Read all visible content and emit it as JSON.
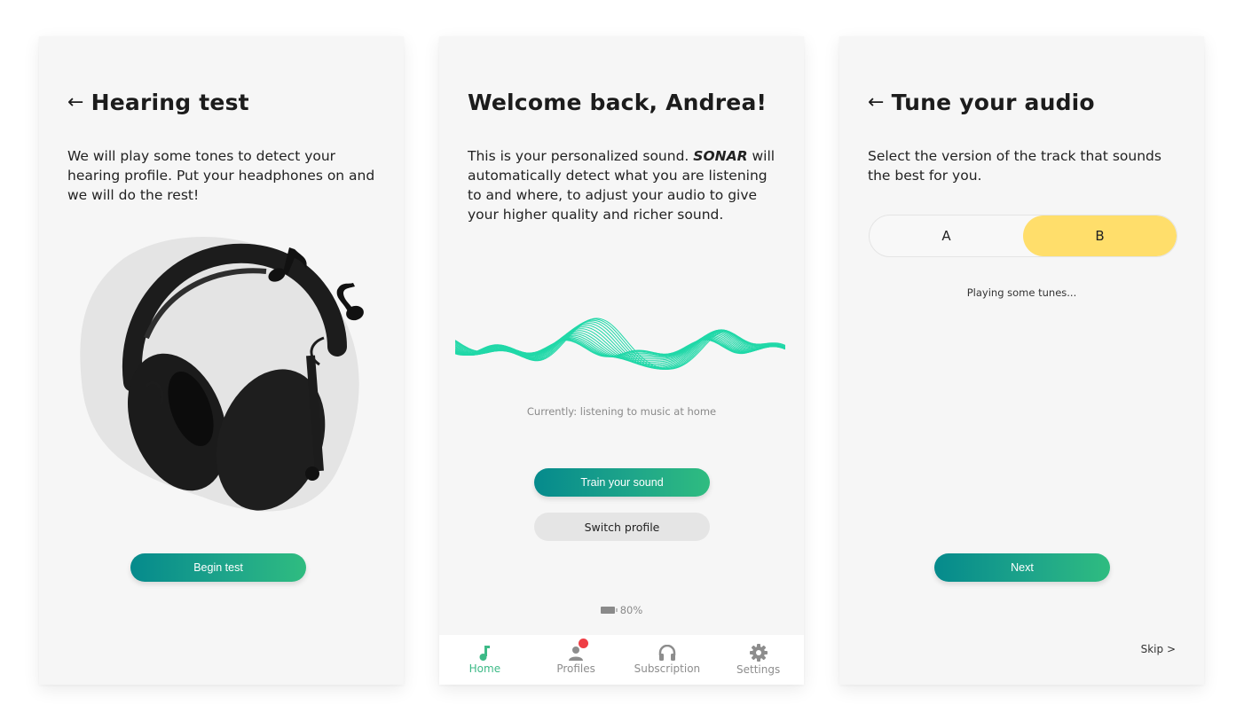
{
  "screens": {
    "hearing_test": {
      "back_icon": "arrow-left-icon",
      "title": "Hearing test",
      "description": "We will play some tones to detect your hearing profile. Put your headphones on and we will do the rest!",
      "illustration": "headphones-with-music-notes",
      "begin_button": "Begin test"
    },
    "home": {
      "title": "Welcome back, Andrea!",
      "description_pre": "This is your personalized sound. ",
      "brand": "SONAR",
      "description_post": " will automatically detect what you are listening to and where, to adjust your audio to give your higher quality and richer sound.",
      "status": "Currently: listening to music at home",
      "train_button": "Train your sound",
      "switch_button": "Switch profile",
      "battery": "80%",
      "tabs": [
        {
          "label": "Home",
          "icon": "music-note-icon",
          "active": true
        },
        {
          "label": "Profiles",
          "icon": "person-icon",
          "badge": true
        },
        {
          "label": "Subscription",
          "icon": "headphones-icon"
        },
        {
          "label": "Settings",
          "icon": "gear-icon"
        }
      ]
    },
    "tune": {
      "back_icon": "arrow-left-icon",
      "title": "Tune your audio",
      "description": "Select the version of the track that sounds the best for you.",
      "options": [
        "A",
        "B"
      ],
      "selected": "B",
      "playing": "Playing some tunes...",
      "next_button": "Next",
      "skip": "Skip >"
    }
  },
  "colors": {
    "accent_start": "#058a8c",
    "accent_end": "#2fbc80",
    "wave": "#20d8a8",
    "selected_option": "#ffde6b",
    "badge": "#ef3e45",
    "active_tab": "#3dba87"
  }
}
